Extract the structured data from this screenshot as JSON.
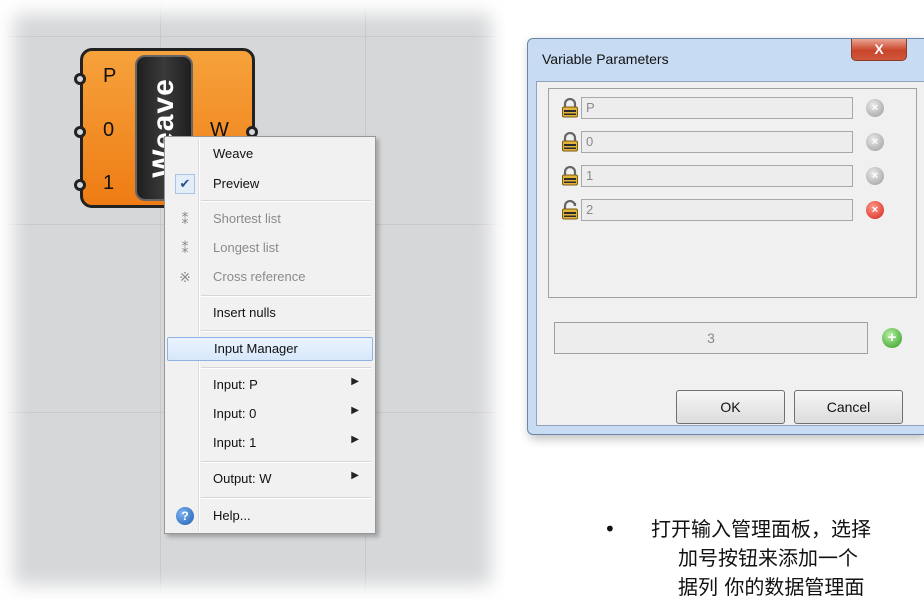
{
  "component": {
    "name": "Weave",
    "inputs": [
      "P",
      "0",
      "1"
    ],
    "output": "W",
    "color": "#f28c22"
  },
  "context_menu": {
    "items": [
      {
        "label": "Weave"
      },
      {
        "label": "Preview",
        "checked": true
      },
      {
        "label": "Shortest list",
        "disabled": true
      },
      {
        "label": "Longest list",
        "disabled": true
      },
      {
        "label": "Cross reference",
        "disabled": true
      },
      {
        "label": "Insert nulls"
      },
      {
        "label": "Input Manager",
        "highlighted": true
      },
      {
        "label": "Input: P",
        "submenu": true
      },
      {
        "label": "Input: 0",
        "submenu": true
      },
      {
        "label": "Input: 1",
        "submenu": true
      },
      {
        "label": "Output: W",
        "submenu": true
      },
      {
        "label": "Help...",
        "icon": "help-icon"
      }
    ]
  },
  "dialog": {
    "title": "Variable Parameters",
    "close_label": "X",
    "params": [
      {
        "value": "P",
        "locked": true
      },
      {
        "value": "0",
        "locked": true
      },
      {
        "value": "1",
        "locked": true
      },
      {
        "value": "2",
        "locked": false
      }
    ],
    "count": "3",
    "ok_label": "OK",
    "cancel_label": "Cancel"
  },
  "bullet": {
    "line1": "打开输入管理面板，选择",
    "line2": "加号按钮来添加一个",
    "line3": "据列 你的数据管理面"
  }
}
